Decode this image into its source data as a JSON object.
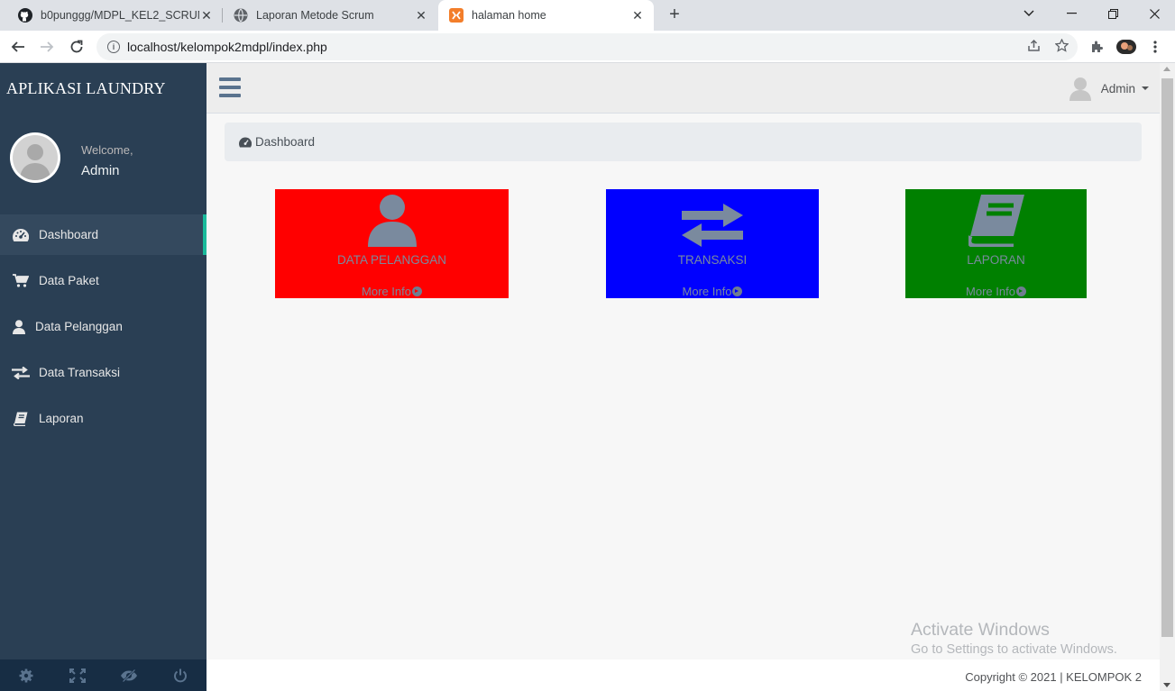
{
  "browser": {
    "tabs": [
      {
        "title": "b0punggg/MDPL_KEL2_SCRUM",
        "icon": "github-icon"
      },
      {
        "title": "Laporan Metode Scrum",
        "icon": "globe-icon"
      },
      {
        "title": "halaman home",
        "icon": "xampp-icon",
        "active": true
      }
    ],
    "url": "localhost/kelompok2mdpl/index.php"
  },
  "sidebar": {
    "brand": "APLIKASI LAUNDRY",
    "welcome": "Welcome,",
    "user_name": "Admin",
    "items": [
      {
        "label": "Dashboard",
        "icon": "dashboard-icon",
        "active": true
      },
      {
        "label": "Data Paket",
        "icon": "cart-icon"
      },
      {
        "label": "Data Pelanggan",
        "icon": "user-icon"
      },
      {
        "label": "Data Transaksi",
        "icon": "exchange-icon"
      },
      {
        "label": "Laporan",
        "icon": "book-icon"
      }
    ],
    "footer_icons": [
      "settings-icon",
      "fullscreen-icon",
      "eye-slash-icon",
      "power-icon"
    ]
  },
  "topnav": {
    "user_label": "Admin"
  },
  "breadcrumb": {
    "label": "Dashboard"
  },
  "tiles": [
    {
      "title": "DATA PELANGGAN",
      "more": "More Info",
      "color": "#ff0000",
      "icon": "user-icon"
    },
    {
      "title": "TRANSAKSI",
      "more": "More Info",
      "color": "#0000ff",
      "icon": "exchange-icon"
    },
    {
      "title": "LAPORAN",
      "more": "More Info",
      "color": "#008000",
      "icon": "book-icon"
    }
  ],
  "watermark": {
    "line1": "Activate Windows",
    "line2": "Go to Settings to activate Windows."
  },
  "footer": {
    "copyright": "Copyright © 2021 | KELOMPOK 2"
  }
}
